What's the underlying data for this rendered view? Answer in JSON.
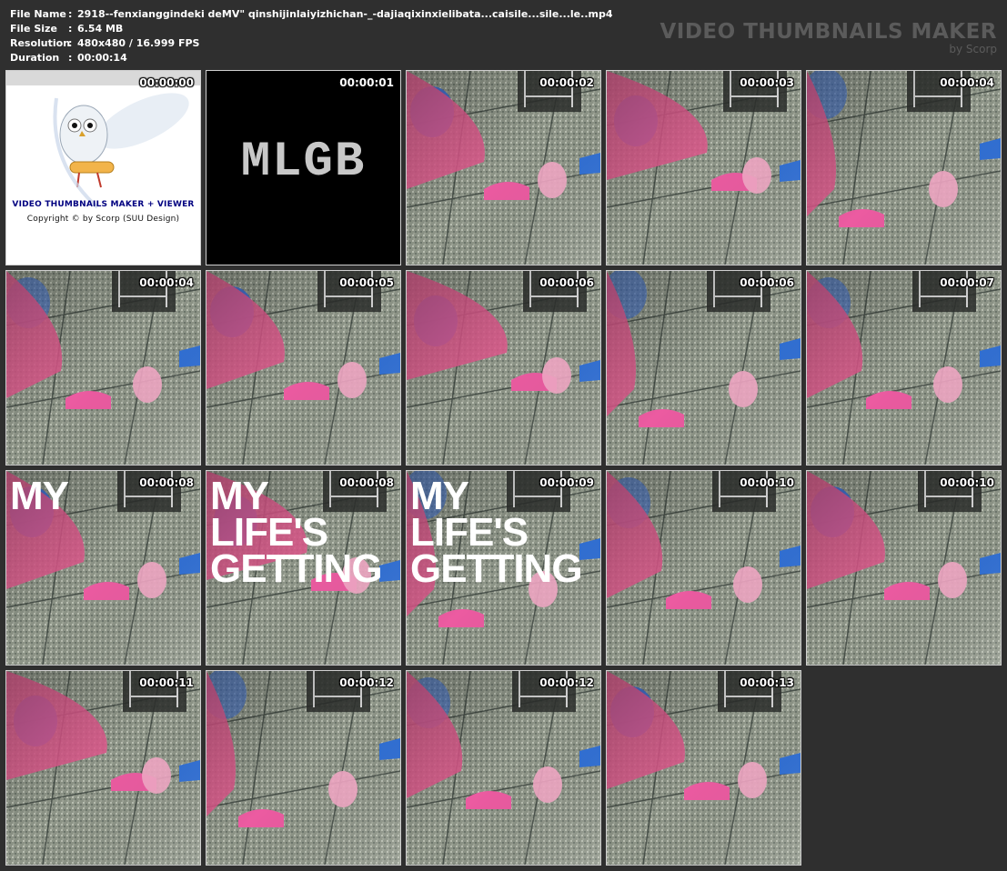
{
  "header": {
    "file_name_label": "File Name",
    "file_name_value": "2918--fenxianggindeki deMV\" qinshijinlaiyizhichan-_-dajiaqixinxielibata...caisile...sile...le..mp4",
    "file_size_label": "File Size",
    "file_size_value": "6.54 MB",
    "resolution_label": "Resolution",
    "resolution_value": "480x480 / 16.999 FPS",
    "duration_label": "Duration",
    "duration_value": "00:00:14",
    "separator": ":"
  },
  "brand": {
    "title": "VIDEO THUMBNAILS MAKER",
    "subtitle": "by Scorp"
  },
  "intro_tile": {
    "logo_text": "VIDEO THUMBNAILS MAKER + VIEWER",
    "copyright": "Copyright © by Scorp (SUU Design)"
  },
  "mlgb_tile": {
    "text": "MLGB"
  },
  "colors": {
    "background": "#2f2f2f",
    "tile_border": "#cfcfcf",
    "brand_gray": "#5b5b5b",
    "floor": "#8e9486",
    "pink": "#e0588d",
    "blue": "#2f6fd6"
  },
  "thumbnails": [
    {
      "time": "00:00:00",
      "kind": "intro",
      "overlay": ""
    },
    {
      "time": "00:00:01",
      "kind": "mlgb",
      "overlay": ""
    },
    {
      "time": "00:00:02",
      "kind": "floor",
      "overlay": ""
    },
    {
      "time": "00:00:03",
      "kind": "floor",
      "overlay": ""
    },
    {
      "time": "00:00:04",
      "kind": "floor",
      "overlay": ""
    },
    {
      "time": "00:00:04",
      "kind": "floor",
      "overlay": ""
    },
    {
      "time": "00:00:05",
      "kind": "floor",
      "overlay": ""
    },
    {
      "time": "00:00:06",
      "kind": "floor",
      "overlay": ""
    },
    {
      "time": "00:00:06",
      "kind": "floor",
      "overlay": ""
    },
    {
      "time": "00:00:07",
      "kind": "floor",
      "overlay": ""
    },
    {
      "time": "00:00:08",
      "kind": "floor",
      "overlay": "MY"
    },
    {
      "time": "00:00:08",
      "kind": "floor",
      "overlay": "MY LIFE'S GETTING"
    },
    {
      "time": "00:00:09",
      "kind": "floor",
      "overlay": "MY LIFE'S GETTING"
    },
    {
      "time": "00:00:10",
      "kind": "floor",
      "overlay": ""
    },
    {
      "time": "00:00:10",
      "kind": "floor",
      "overlay": ""
    },
    {
      "time": "00:00:11",
      "kind": "floor",
      "overlay": ""
    },
    {
      "time": "00:00:12",
      "kind": "floor",
      "overlay": ""
    },
    {
      "time": "00:00:12",
      "kind": "floor",
      "overlay": ""
    },
    {
      "time": "00:00:13",
      "kind": "floor",
      "overlay": ""
    }
  ]
}
